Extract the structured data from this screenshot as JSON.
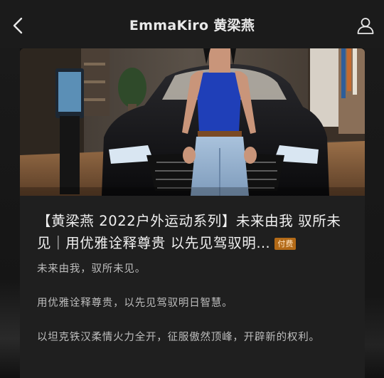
{
  "header": {
    "title": "EmmaKiro 黄梁燕",
    "back_icon": "chevron-left-icon",
    "profile_icon": "user-icon"
  },
  "article": {
    "title_main": "【黄梁燕 2022户外运动系列】未来由我 驭所未见｜用优雅诠释尊贵 以先见驾驭明…",
    "badge": "付费",
    "paragraphs": [
      "未来由我，驭所未见。",
      "用优雅诠释尊贵，以先见驾驭明日智慧。",
      "以坦克铁汉柔情火力全开，征服傲然顶峰，开辟新的权利。"
    ]
  },
  "colors": {
    "background": "#101010",
    "navbar": "#1b1b1b",
    "card": "#1f1f1f",
    "badge": "#b36a17",
    "title_text": "#f0f0f0",
    "body_text": "#bdbdbd"
  }
}
